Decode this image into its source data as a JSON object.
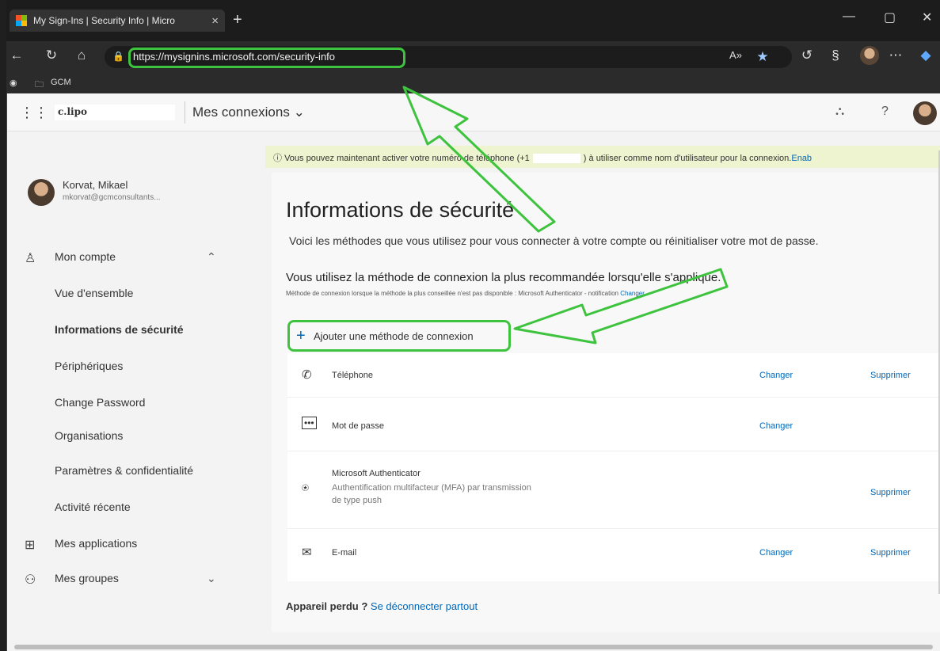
{
  "browser": {
    "tab_title": "My Sign-Ins | Security Info | Micro",
    "url": "https://mysignins.microsoft.com/security-info",
    "bookmark_folder": "GCM"
  },
  "header": {
    "logo_text": "c.lipo",
    "app_name": "Mes connexions",
    "help_icon": "?"
  },
  "sidebar": {
    "user_name": "Korvat, Mikael",
    "user_email": "mkorvat@gcmconsultants...",
    "account_label": "Mon compte",
    "subitems": [
      "Vue d'ensemble",
      "Informations de sécurité",
      "Périphériques",
      "Change Password",
      "Organisations",
      "Paramètres & confidentialité",
      "Activité récente"
    ],
    "apps_label": "Mes applications",
    "groups_label": "Mes groupes"
  },
  "notice": {
    "text_before": "Vous pouvez maintenant activer votre numéro de téléphone (+1",
    "text_after": ") à utiliser comme nom d'utilisateur pour la connexion.",
    "link": "Enab"
  },
  "content": {
    "title": "Informations de sécurité",
    "description": "Voici les méthodes que vous utilisez pour vous connecter à votre compte ou réinitialiser votre mot de passe.",
    "recommend": "Vous utilisez la méthode de connexion la plus recommandée lorsqu'elle s'applique.",
    "fine_print": "Méthode de connexion lorsque la méthode la plus conseillée n'est pas disponible : Microsoft Authenticator - notification",
    "fine_link": "Changer",
    "add_method": "Ajouter une méthode de connexion",
    "methods": [
      {
        "name": "Téléphone",
        "detail": "",
        "change": "Changer",
        "remove": "Supprimer"
      },
      {
        "name": "Mot de passe",
        "detail": "",
        "change": "Changer",
        "remove": ""
      },
      {
        "name": "Microsoft Authenticator",
        "detail": "Authentification multifacteur (MFA) par transmission de type push",
        "change": "",
        "remove": "Supprimer"
      },
      {
        "name": "E-mail",
        "detail": "",
        "change": "Changer",
        "remove": "Supprimer"
      }
    ],
    "lost_device": "Appareil perdu ?",
    "lost_link": "Se déconnecter partout"
  },
  "annotation_color": "#3ec33e"
}
